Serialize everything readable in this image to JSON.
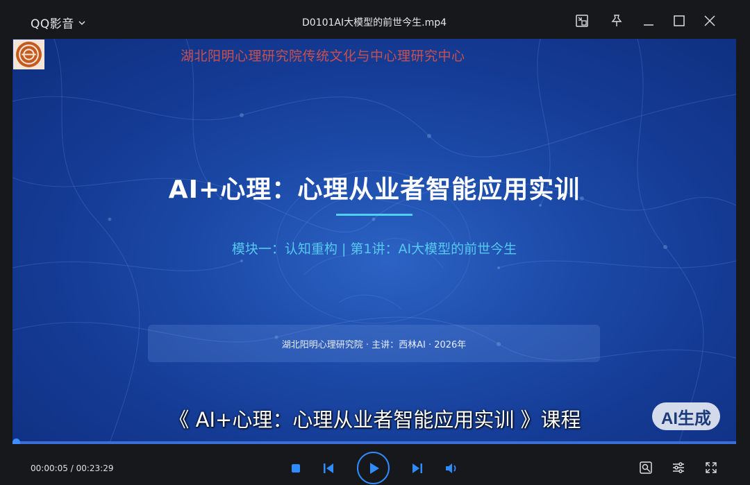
{
  "titlebar": {
    "app_name": "QQ影音",
    "file_title": "D0101AI大模型的前世今生.mp4"
  },
  "video": {
    "institute_header": "湖北阳明心理研究院传统文化与中心理研究中心",
    "slide_title": "AI+心理：心理从业者智能应用实训",
    "slide_subtitle": "模块一：认知重构 | 第1讲：AI大模型的前世今生",
    "info_line": "湖北阳明心理研究院 · 主讲：西林AI · 2026年",
    "caption": "《 AI+心理：心理从业者智能应用实训 》课程",
    "ai_badge": "AI生成"
  },
  "playback": {
    "current_time": "00:00:05",
    "separator": " / ",
    "total_time": "00:23:29",
    "progress_fraction": 0.0035
  },
  "icons": {
    "titlebar": [
      "mini-mode-icon",
      "pin-icon",
      "minimize-icon",
      "maximize-icon",
      "close-icon"
    ],
    "controls": [
      "stop-icon",
      "previous-icon",
      "play-icon",
      "next-icon",
      "volume-icon",
      "screenshot-icon",
      "settings-icon",
      "fullscreen-icon"
    ]
  },
  "colors": {
    "accent": "#2f8cff",
    "institute_text": "#c9504f",
    "subtitle_text": "#56c9ef",
    "title_underline": "#4fd0f0"
  }
}
